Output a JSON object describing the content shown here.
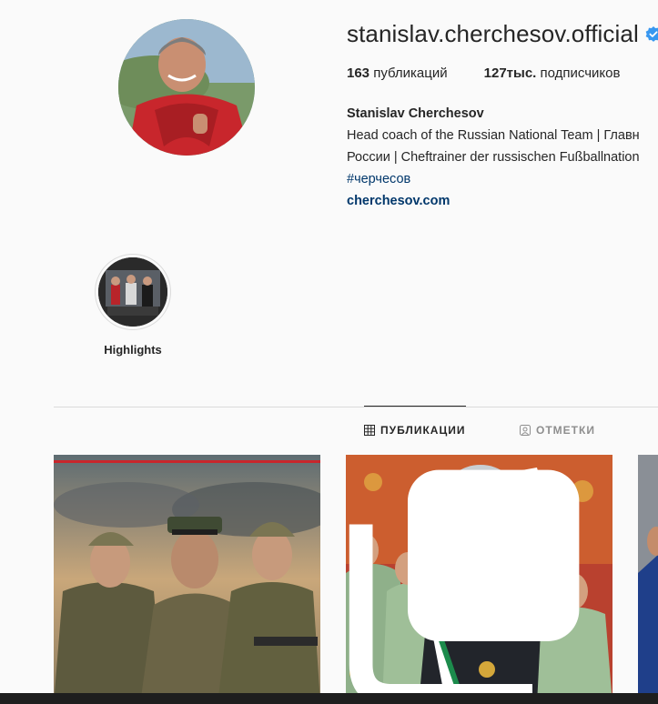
{
  "profile": {
    "username": "stanislav.cherchesov.official",
    "verified_icon": "verified-badge-icon",
    "stats": {
      "posts_count": "163",
      "posts_label": "публикаций",
      "followers_count": "127тыс.",
      "followers_label": "подписчиков"
    },
    "bio": {
      "full_name": "Stanislav Cherchesov",
      "line1": "Head coach of the Russian National Team | Главн",
      "line2": "России | Cheftrainer der russischen Fußballnation",
      "hashtag": "#черчесов",
      "website": "cherchesov.com"
    }
  },
  "highlights": [
    {
      "label": "Highlights"
    }
  ],
  "tabs": {
    "posts": {
      "label": "ПУБЛИКАЦИИ",
      "icon": "grid-icon"
    },
    "tagged": {
      "label": "ОТМЕТКИ",
      "icon": "tagged-user-icon"
    }
  },
  "colors": {
    "background": "#fafafa",
    "link": "#00376b",
    "verified": "#3897f0",
    "muted": "#8e8e8e",
    "divider": "#dbdbdb"
  }
}
